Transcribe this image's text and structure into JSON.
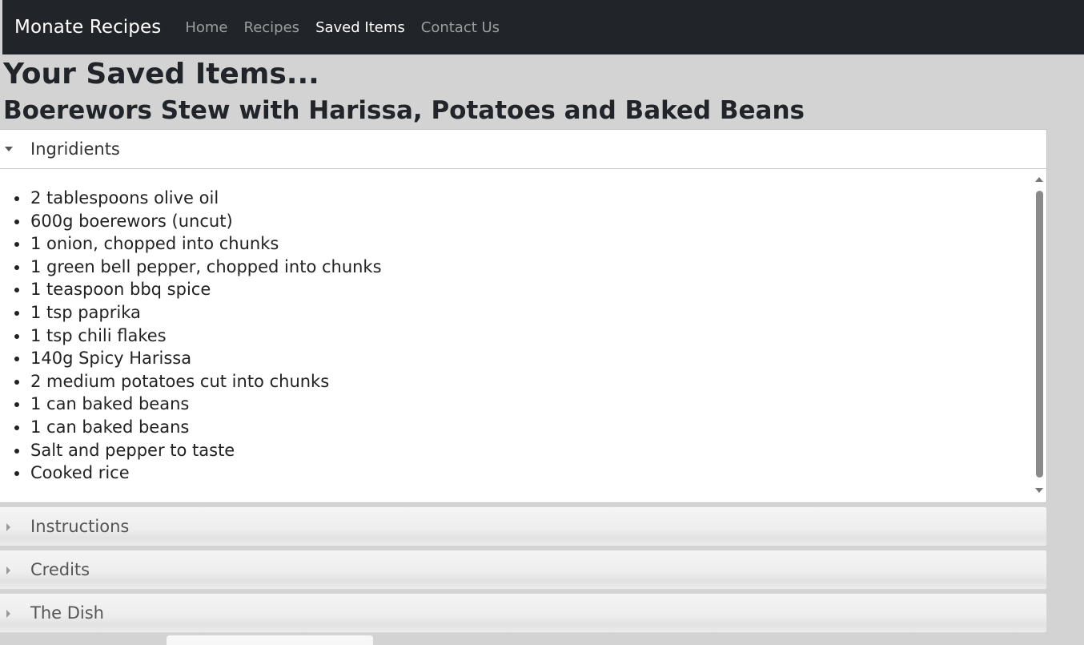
{
  "navbar": {
    "brand": "Monate Recipes",
    "links": [
      {
        "label": "Home",
        "active": false
      },
      {
        "label": "Recipes",
        "active": false
      },
      {
        "label": "Saved Items",
        "active": true
      },
      {
        "label": "Contact Us",
        "active": false
      }
    ]
  },
  "page": {
    "title": "Your Saved Items...",
    "recipe_title": "Boerewors Stew with Harissa, Potatoes and Baked Beans"
  },
  "accordion": {
    "open_section": {
      "label": "Ingridients",
      "items": [
        "2 tablespoons olive oil",
        "600g boerewors (uncut)",
        "1 onion, chopped into chunks",
        "1 green bell pepper, chopped into chunks",
        "1 teaspoon bbq spice",
        "1 tsp paprika",
        "1 tsp chili flakes",
        "140g Spicy Harissa",
        "2 medium potatoes cut into chunks",
        "1 can baked beans",
        "1 can baked beans",
        "Salt and pepper to taste",
        "Cooked rice"
      ]
    },
    "closed_sections": [
      {
        "label": "Instructions"
      },
      {
        "label": "Credits"
      },
      {
        "label": "The Dish"
      }
    ]
  },
  "colors": {
    "navbar_bg": "#212529",
    "page_bg": "#d3d3d3",
    "nav_active": "#ffffff",
    "nav_inactive": "#9b9d9f"
  }
}
